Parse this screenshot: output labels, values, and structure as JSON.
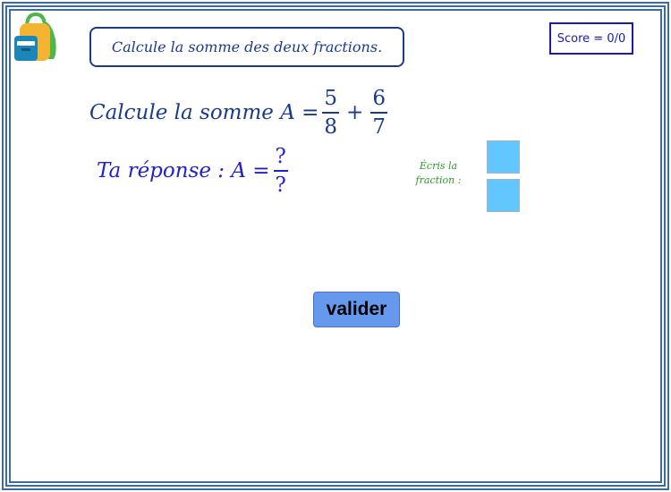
{
  "instruction": "Calcule la somme des deux fractions.",
  "score": "Score = 0/0",
  "question": {
    "prefix": "Calcule la somme A =",
    "fraction1": {
      "numerator": "5",
      "denominator": "8"
    },
    "operator": "+",
    "fraction2": {
      "numerator": "6",
      "denominator": "7"
    }
  },
  "answer": {
    "prefix": "Ta réponse : A =",
    "numerator": "?",
    "denominator": "?"
  },
  "hint": {
    "line1": "Écris la",
    "line2": "fraction :"
  },
  "inputs": {
    "numerator_value": "",
    "denominator_value": "",
    "color": "#63c7ff"
  },
  "validate_label": "valider",
  "colors": {
    "frame": "#3a6c9c",
    "instruction_text": "#1a3a8c",
    "answer_text": "#2222c8",
    "hint_text": "#2a9a2a",
    "button": "#6699ee"
  },
  "icons": {
    "logo": "backpack-icon"
  }
}
